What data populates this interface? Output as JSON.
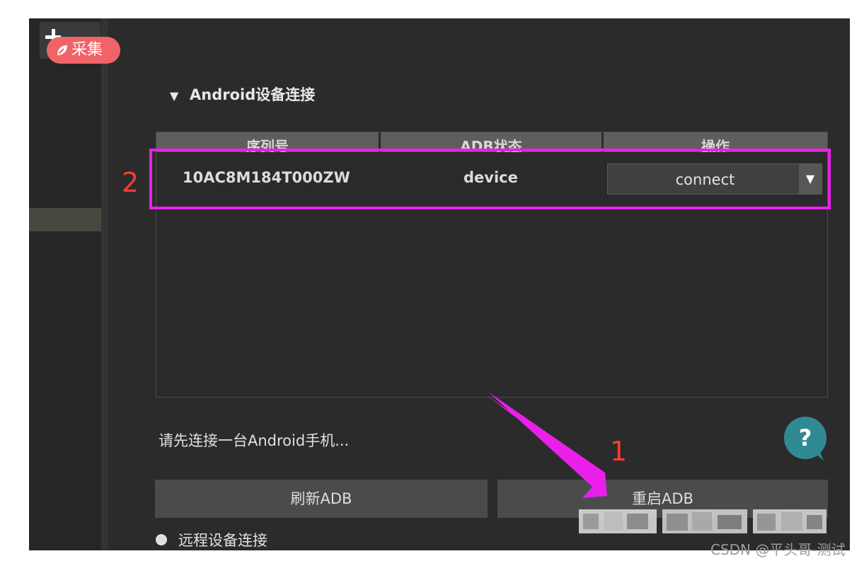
{
  "badge": {
    "label": "采集",
    "icon": "leaf-icon",
    "color": "#f06468"
  },
  "section": {
    "title": "Android设备连接",
    "toggle_icon": "triangle-down-icon"
  },
  "table": {
    "headers": [
      "序列号",
      "ADB状态",
      "操作"
    ],
    "rows": [
      {
        "serial": "10AC8M184T000ZW",
        "status": "device",
        "action": "connect"
      }
    ]
  },
  "hint": "请先连接一台Android手机...",
  "buttons": {
    "refresh": "刷新ADB",
    "restart": "重启ADB"
  },
  "remote": {
    "label": "远程设备连接"
  },
  "annotations": {
    "step1": "1",
    "step2": "2",
    "highlight_color": "#ea20ea",
    "number_color": "#ff3b30"
  },
  "watermark": "CSDN @平头哥-测试"
}
